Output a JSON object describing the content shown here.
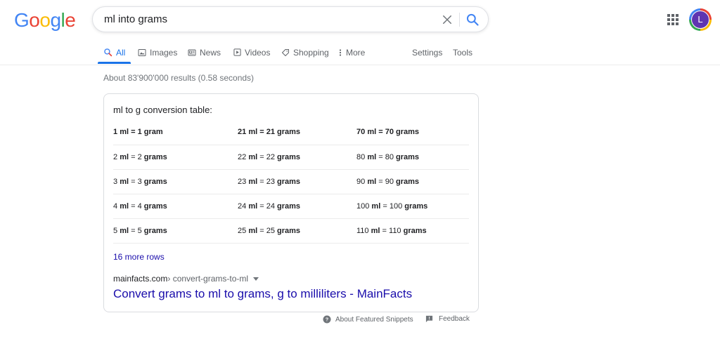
{
  "logo": {
    "letters": [
      "G",
      "o",
      "o",
      "g",
      "l",
      "e"
    ]
  },
  "search": {
    "query": "ml into grams"
  },
  "account": {
    "avatar_letter": "L"
  },
  "tabs": [
    {
      "label": "All",
      "icon": "search-icon"
    },
    {
      "label": "Images",
      "icon": "image-icon"
    },
    {
      "label": "News",
      "icon": "news-icon"
    },
    {
      "label": "Videos",
      "icon": "play-icon"
    },
    {
      "label": "Shopping",
      "icon": "tag-icon"
    },
    {
      "label": "More",
      "icon": "more-vert-icon"
    }
  ],
  "tools": {
    "settings": "Settings",
    "tools": "Tools"
  },
  "results": {
    "stats": "About 83'900'000 results (0.58 seconds)"
  },
  "snippet": {
    "table_title": "ml to g conversion table:",
    "rows": [
      [
        {
          "num": "1",
          "unit": "ml",
          "eq": "=",
          "val": "1",
          "val_unit": "gram"
        },
        {
          "num": "21",
          "unit": "ml",
          "eq": "=",
          "val": "21",
          "val_unit": "grams"
        },
        {
          "num": "70",
          "unit": "ml",
          "eq": "=",
          "val": "70",
          "val_unit": "grams"
        }
      ],
      [
        {
          "num": "2",
          "unit": "ml",
          "eq": "=",
          "val": "2",
          "val_unit": "grams"
        },
        {
          "num": "22",
          "unit": "ml",
          "eq": "=",
          "val": "22",
          "val_unit": "grams"
        },
        {
          "num": "80",
          "unit": "ml",
          "eq": "=",
          "val": "80",
          "val_unit": "grams"
        }
      ],
      [
        {
          "num": "3",
          "unit": "ml",
          "eq": "=",
          "val": "3",
          "val_unit": "grams"
        },
        {
          "num": "23",
          "unit": "ml",
          "eq": "=",
          "val": "23",
          "val_unit": "grams"
        },
        {
          "num": "90",
          "unit": "ml",
          "eq": "=",
          "val": "90",
          "val_unit": "grams"
        }
      ],
      [
        {
          "num": "4",
          "unit": "ml",
          "eq": "=",
          "val": "4",
          "val_unit": "grams"
        },
        {
          "num": "24",
          "unit": "ml",
          "eq": "=",
          "val": "24",
          "val_unit": "grams"
        },
        {
          "num": "100",
          "unit": "ml",
          "eq": "=",
          "val": "100",
          "val_unit": "grams"
        }
      ],
      [
        {
          "num": "5",
          "unit": "ml",
          "eq": "=",
          "val": "5",
          "val_unit": "grams"
        },
        {
          "num": "25",
          "unit": "ml",
          "eq": "=",
          "val": "25",
          "val_unit": "grams"
        },
        {
          "num": "110",
          "unit": "ml",
          "eq": "=",
          "val": "110",
          "val_unit": "grams"
        }
      ]
    ],
    "more_rows": "16 more rows",
    "cite_domain": "mainfacts.com",
    "cite_path": " › convert-grams-to-ml",
    "result_title": "Convert grams to ml to grams, g to milliliters - MainFacts"
  },
  "footer": {
    "about": "About Featured Snippets",
    "feedback": "Feedback"
  },
  "colors": {
    "link": "#1a0dab",
    "active_tab": "#1a73e8",
    "muted": "#70757a"
  }
}
